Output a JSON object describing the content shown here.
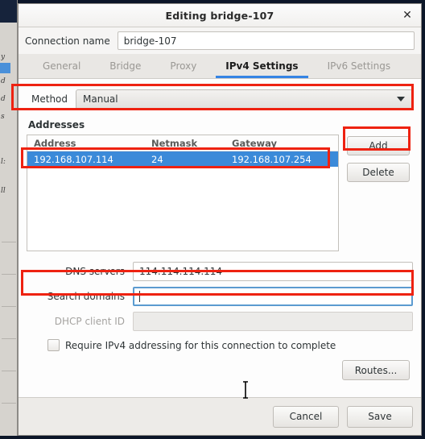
{
  "window": {
    "title": "Editing bridge-107",
    "close_icon": "close-icon"
  },
  "connection": {
    "label": "Connection name",
    "value": "bridge-107",
    "placeholder": ""
  },
  "tabs": [
    {
      "label": "General",
      "active": false
    },
    {
      "label": "Bridge",
      "active": false
    },
    {
      "label": "Proxy",
      "active": false
    },
    {
      "label": "IPv4 Settings",
      "active": true
    },
    {
      "label": "IPv6 Settings",
      "active": false
    }
  ],
  "method": {
    "label": "Method",
    "value": "Manual",
    "arrow_icon": "chevron-down-icon"
  },
  "addresses": {
    "section_title": "Addresses",
    "columns": [
      "Address",
      "Netmask",
      "Gateway"
    ],
    "rows": [
      {
        "address": "192.168.107.114",
        "netmask": "24",
        "gateway": "192.168.107.254",
        "selected": true
      }
    ],
    "add_label": "Add",
    "delete_label": "Delete"
  },
  "fields": {
    "dns_label": "DNS servers",
    "dns_value": "114.114.114.114",
    "search_label": "Search domains",
    "search_value": "",
    "dhcp_label": "DHCP client ID",
    "dhcp_value": "",
    "require_label": "Require IPv4 addressing for this connection to complete",
    "require_checked": false
  },
  "buttons": {
    "routes_label": "Routes...",
    "cancel_label": "Cancel",
    "save_label": "Save"
  },
  "colors": {
    "accent_blue": "#3584e4",
    "selection_blue": "#3b8ad9",
    "annotation_red": "#ee2211",
    "focus_border": "#5b9bd0"
  },
  "background_window": {
    "lines": [
      "y",
      "d",
      "d",
      "s",
      "l:",
      "ll"
    ]
  }
}
